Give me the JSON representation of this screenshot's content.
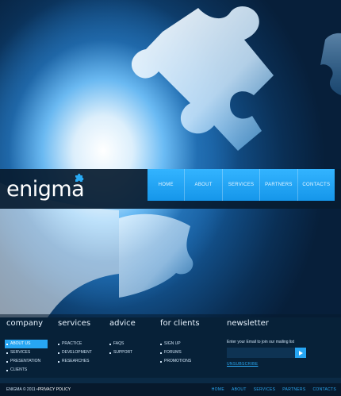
{
  "brand": {
    "name": "enigma"
  },
  "nav": {
    "items": [
      {
        "label": "HOME"
      },
      {
        "label": "ABOUT"
      },
      {
        "label": "SERVICES"
      },
      {
        "label": "PARTNERS"
      },
      {
        "label": "CONTACTS"
      }
    ]
  },
  "footer": {
    "company": {
      "title": "company",
      "items": [
        "ABOUT US",
        "SERVICES",
        "PRESENTATION",
        "CLIENTS"
      ],
      "active_index": 0
    },
    "services": {
      "title": "services",
      "items": [
        "PRACTICE",
        "DEVELOPMENT",
        "RESEARCHES"
      ]
    },
    "advice": {
      "title": "advice",
      "items": [
        "FAQS",
        "SUPPORT"
      ]
    },
    "for_clients": {
      "title": "for clients",
      "items": [
        "SIGN UP",
        "FORUMS",
        "PROMOTIONS"
      ]
    },
    "newsletter": {
      "title": "newsletter",
      "prompt": "Enter your Email to join our mailing list",
      "email_value": "",
      "unsubscribe": "UNSUBSCRIBE"
    }
  },
  "bottom": {
    "copyright": "ENIGMA © 2011 •",
    "privacy": "PRIVACY POLICY",
    "nav": [
      "HOME",
      "ABOUT",
      "SERVICES",
      "PARTNERS",
      "CONTACTS"
    ]
  },
  "colors": {
    "accent": "#27a6f3",
    "dark": "#07192c"
  }
}
